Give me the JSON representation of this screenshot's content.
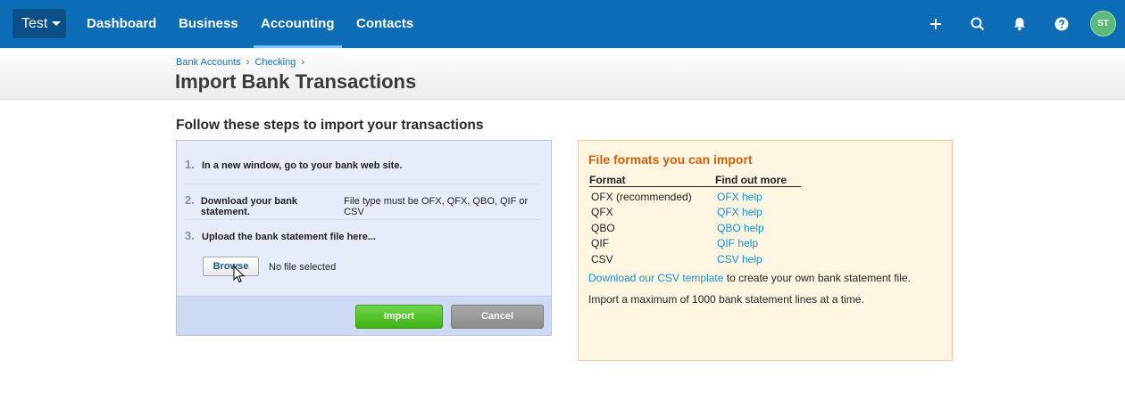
{
  "nav": {
    "org": "Test",
    "items": [
      {
        "label": "Dashboard"
      },
      {
        "label": "Business"
      },
      {
        "label": "Accounting"
      },
      {
        "label": "Contacts"
      }
    ],
    "active": "Accounting",
    "avatar_initials": "ST",
    "icons": [
      "plus-icon",
      "search-icon",
      "bell-icon",
      "help-icon"
    ]
  },
  "breadcrumb": {
    "items": [
      "Bank Accounts",
      "Checking"
    ],
    "separator": "›"
  },
  "page": {
    "title": "Import Bank Transactions",
    "steps_heading": "Follow these steps to import your transactions"
  },
  "steps": [
    {
      "num": "1.",
      "bold": "In a new window, go to your bank web site.",
      "text": ""
    },
    {
      "num": "2.",
      "bold": "Download your bank statement.",
      "text": "File type must be OFX, QFX, QBO, QIF or CSV"
    },
    {
      "num": "3.",
      "bold": "Upload the bank statement file here...",
      "text": ""
    }
  ],
  "upload": {
    "browse_label": "Browse",
    "file_status": "No file selected"
  },
  "actions": {
    "import_label": "Import",
    "cancel_label": "Cancel"
  },
  "formats": {
    "title": "File formats you can import",
    "col_format": "Format",
    "col_help": "Find out more",
    "rows": [
      {
        "format": "OFX (recommended)",
        "help": "OFX help"
      },
      {
        "format": "QFX",
        "help": "QFX help"
      },
      {
        "format": "QBO",
        "help": "QBO help"
      },
      {
        "format": "QIF",
        "help": "QIF help"
      },
      {
        "format": "CSV",
        "help": "CSV help"
      }
    ],
    "csv_link": "Download our CSV template",
    "csv_rest": "to create your own bank statement file.",
    "max_lines": "Import a maximum of 1000 bank statement lines at a time."
  },
  "colors": {
    "nav_bg": "#0d6cb6",
    "accent_orange": "#d35f0c",
    "link_blue": "#1a8fd0",
    "import_green": "#3db213"
  }
}
